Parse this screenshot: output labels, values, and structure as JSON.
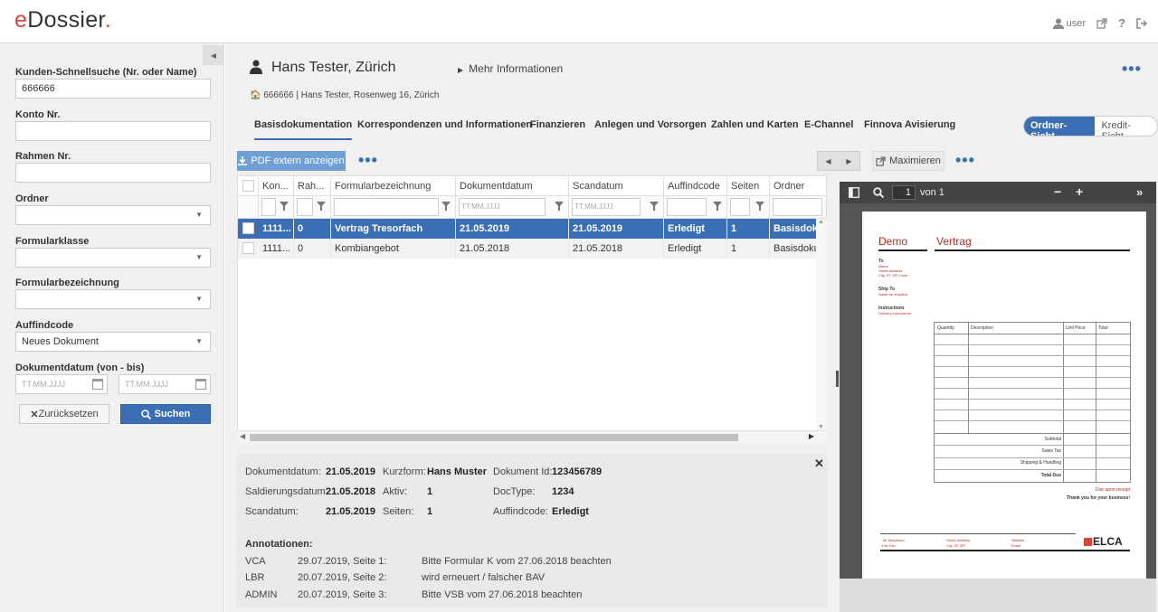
{
  "app": {
    "logo_e": "e",
    "logo_rest": "Dossier",
    "logo_dot": ".",
    "user": "user"
  },
  "sidebar": {
    "quicksearch_label": "Kunden-Schnellsuche (Nr. oder Name)",
    "quicksearch_value": "666666",
    "konto_label": "Konto Nr.",
    "rahmen_label": "Rahmen Nr.",
    "ordner_label": "Ordner",
    "formularklasse_label": "Formularklasse",
    "formularbez_label": "Formularbezeichnung",
    "auffindcode_label": "Auffindcode",
    "auffindcode_value": "Neues Dokument",
    "datum_label": "Dokumentdatum (von - bis)",
    "date_placeholder": "TT.MM.JJJJ",
    "reset_label": "Zurücksetzen",
    "search_label": "Suchen"
  },
  "header": {
    "person": "Hans Tester, Zürich",
    "more_info": "Mehr Informationen",
    "address": "666666 | Hans Tester, Rosenweg 16, Zürich"
  },
  "tabs": [
    "Basisdokumentation",
    "Korrespondenzen und Informationen",
    "Finanzieren",
    "Anlegen und Vorsorgen",
    "Zahlen und Karten",
    "E-Channel",
    "Finnova Avisierung"
  ],
  "view_toggle": {
    "on": "Ordner-Sicht",
    "off": "Kredit-Sicht"
  },
  "grid": {
    "pdf_button": "PDF extern anzeigen",
    "columns": [
      "Kon...",
      "Rah...",
      "Formularbezeichnung",
      "Dokumentdatum",
      "Scandatum",
      "Auffindcode",
      "Seiten",
      "Ordner"
    ],
    "date_placeholder": "TT.MM.JJJJ",
    "rows": [
      [
        "1111...",
        "0",
        "Vertrag Tresorfach",
        "21.05.2019",
        "21.05.2019",
        "Erledigt",
        "1",
        "Basisdoku"
      ],
      [
        "1111...",
        "0",
        "Kombiangebot",
        "21.05.2018",
        "21.05.2018",
        "Erledigt",
        "1",
        "Basisdoku"
      ]
    ]
  },
  "details": {
    "dokumentdatum_l": "Dokumentdatum:",
    "dokumentdatum_v": "21.05.2019",
    "kurzform_l": "Kurzform:",
    "kurzform_v": "Hans Muster",
    "dokid_l": "Dokument Id:",
    "dokid_v": "123456789",
    "saldierung_l": "Saldierungsdatum:",
    "saldierung_v": "21.05.2018",
    "aktiv_l": "Aktiv:",
    "aktiv_v": "1",
    "doctype_l": "DocType:",
    "doctype_v": "1234",
    "scandatum_l": "Scandatum:",
    "scandatum_v": "21.05.2019",
    "seiten_l": "Seiten:",
    "seiten_v": "1",
    "auffind_l": "Auffindcode:",
    "auffind_v": "Erledigt",
    "annot_title": "Annotationen:",
    "annotations": [
      {
        "user": "VCA",
        "when": "29.07.2019, Seite 1:",
        "text": "Bitte Formular K vom 27.06.2018 beachten"
      },
      {
        "user": "LBR",
        "when": "20.07.2019, Seite 2:",
        "text": "wird erneuert / falscher BAV"
      },
      {
        "user": "ADMIN",
        "when": "20.07.2019, Seite 3:",
        "text": "Bitte VSB vom 27.06.2018 beachten"
      }
    ]
  },
  "viewer": {
    "maximize": "Maximieren",
    "page_num": "1",
    "page_of": "von 1",
    "doc_title_left": "Demo",
    "doc_title_right": "Vertrag",
    "to_label": "To",
    "to_lines": [
      "Name",
      "Street Address",
      "City, ST ZIP Code"
    ],
    "shipto_label": "Ship To",
    "shipto_line": "Same as recipient",
    "instr_label": "Instructions",
    "instr_line": "Delivery instructions",
    "table_headers": [
      "Quantity",
      "Description",
      "Unit Price",
      "Total"
    ],
    "subtotal": "Subtotal",
    "salestax": "Sales Tax",
    "shipping": "Shipping & Handling",
    "totaldue": "Total Due",
    "due": "Due upon receipt",
    "thanks": "Thank you for your business!",
    "footer_col1": [
      "Tel Telephone",
      "Fax Fax"
    ],
    "footer_col2": [
      "Street Address",
      "City, ST ZIP"
    ],
    "footer_col3": [
      "Website",
      "Email"
    ],
    "footer_brand": "ELCA"
  }
}
